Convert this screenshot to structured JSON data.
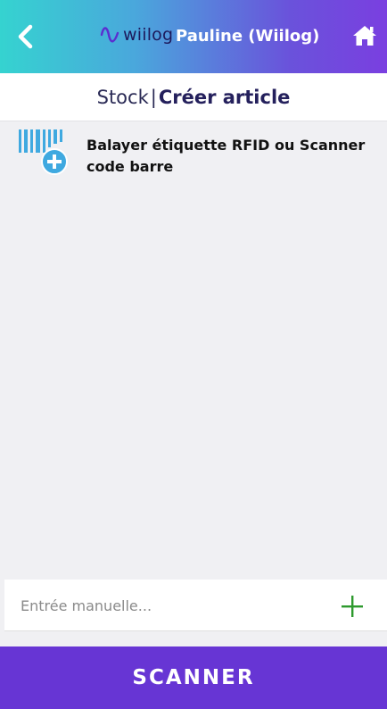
{
  "header": {
    "logo_text": "wiilog",
    "user_name": "Pauline (Wiilog)",
    "back_icon": "chevron-left-icon",
    "home_icon": "home-icon"
  },
  "breadcrumb": {
    "parent": "Stock",
    "separator": "|",
    "current": "Créer article"
  },
  "instruction": {
    "icon": "barcode-add-icon",
    "text": "Balayer étiquette RFID ou Scanner code barre"
  },
  "manual_entry": {
    "value": "",
    "placeholder": "Entrée manuelle...",
    "add_icon": "plus-icon"
  },
  "scan_button": {
    "label": "SCANNER"
  },
  "colors": {
    "header_gradient_start": "#35d3d0",
    "header_gradient_end": "#7a3fe0",
    "primary": "#6735d4",
    "icon_blue": "#3fa9e0",
    "add_green": "#2e9a2e"
  }
}
